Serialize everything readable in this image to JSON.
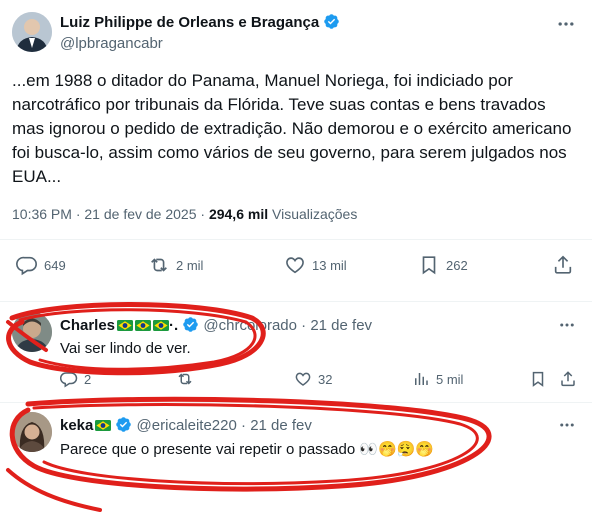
{
  "main_post": {
    "author_name": "Luiz Philippe de Orleans e Bragança",
    "handle": "@lpbragancabr",
    "text": "...em 1988 o ditador do Panama, Manuel Noriega, foi indiciado por narcotráfico por tribunais da Flórida. Teve suas contas e bens travados mas ignorou o pedido de extradição. Não demorou e o exército americano foi busca-lo, assim como vários de seu governo, para serem julgados nos EUA...",
    "time": "10:36 PM",
    "date": "21 de fev de 2025",
    "views_count": "294,6 mil",
    "views_label": "Visualizações",
    "replies": "649",
    "reposts": "2 mil",
    "likes": "13 mil",
    "bookmarks": "262"
  },
  "replies": [
    {
      "author_name": "Charles",
      "handle": "@chrcolorado",
      "date": "21 de fev",
      "text": "Vai ser lindo de ver.",
      "replies": "2",
      "reposts": "",
      "likes": "32",
      "views": "5 mil"
    },
    {
      "author_name": "keka",
      "handle": "@ericaleite220",
      "date": "21 de fev",
      "text": "Parece que o presente vai repetir o passado 👀🤭😮‍💨🤭"
    }
  ],
  "colors": {
    "verified_blue": "#1d9bf0",
    "annotation_red": "#e0201b",
    "muted_text": "#536471"
  }
}
